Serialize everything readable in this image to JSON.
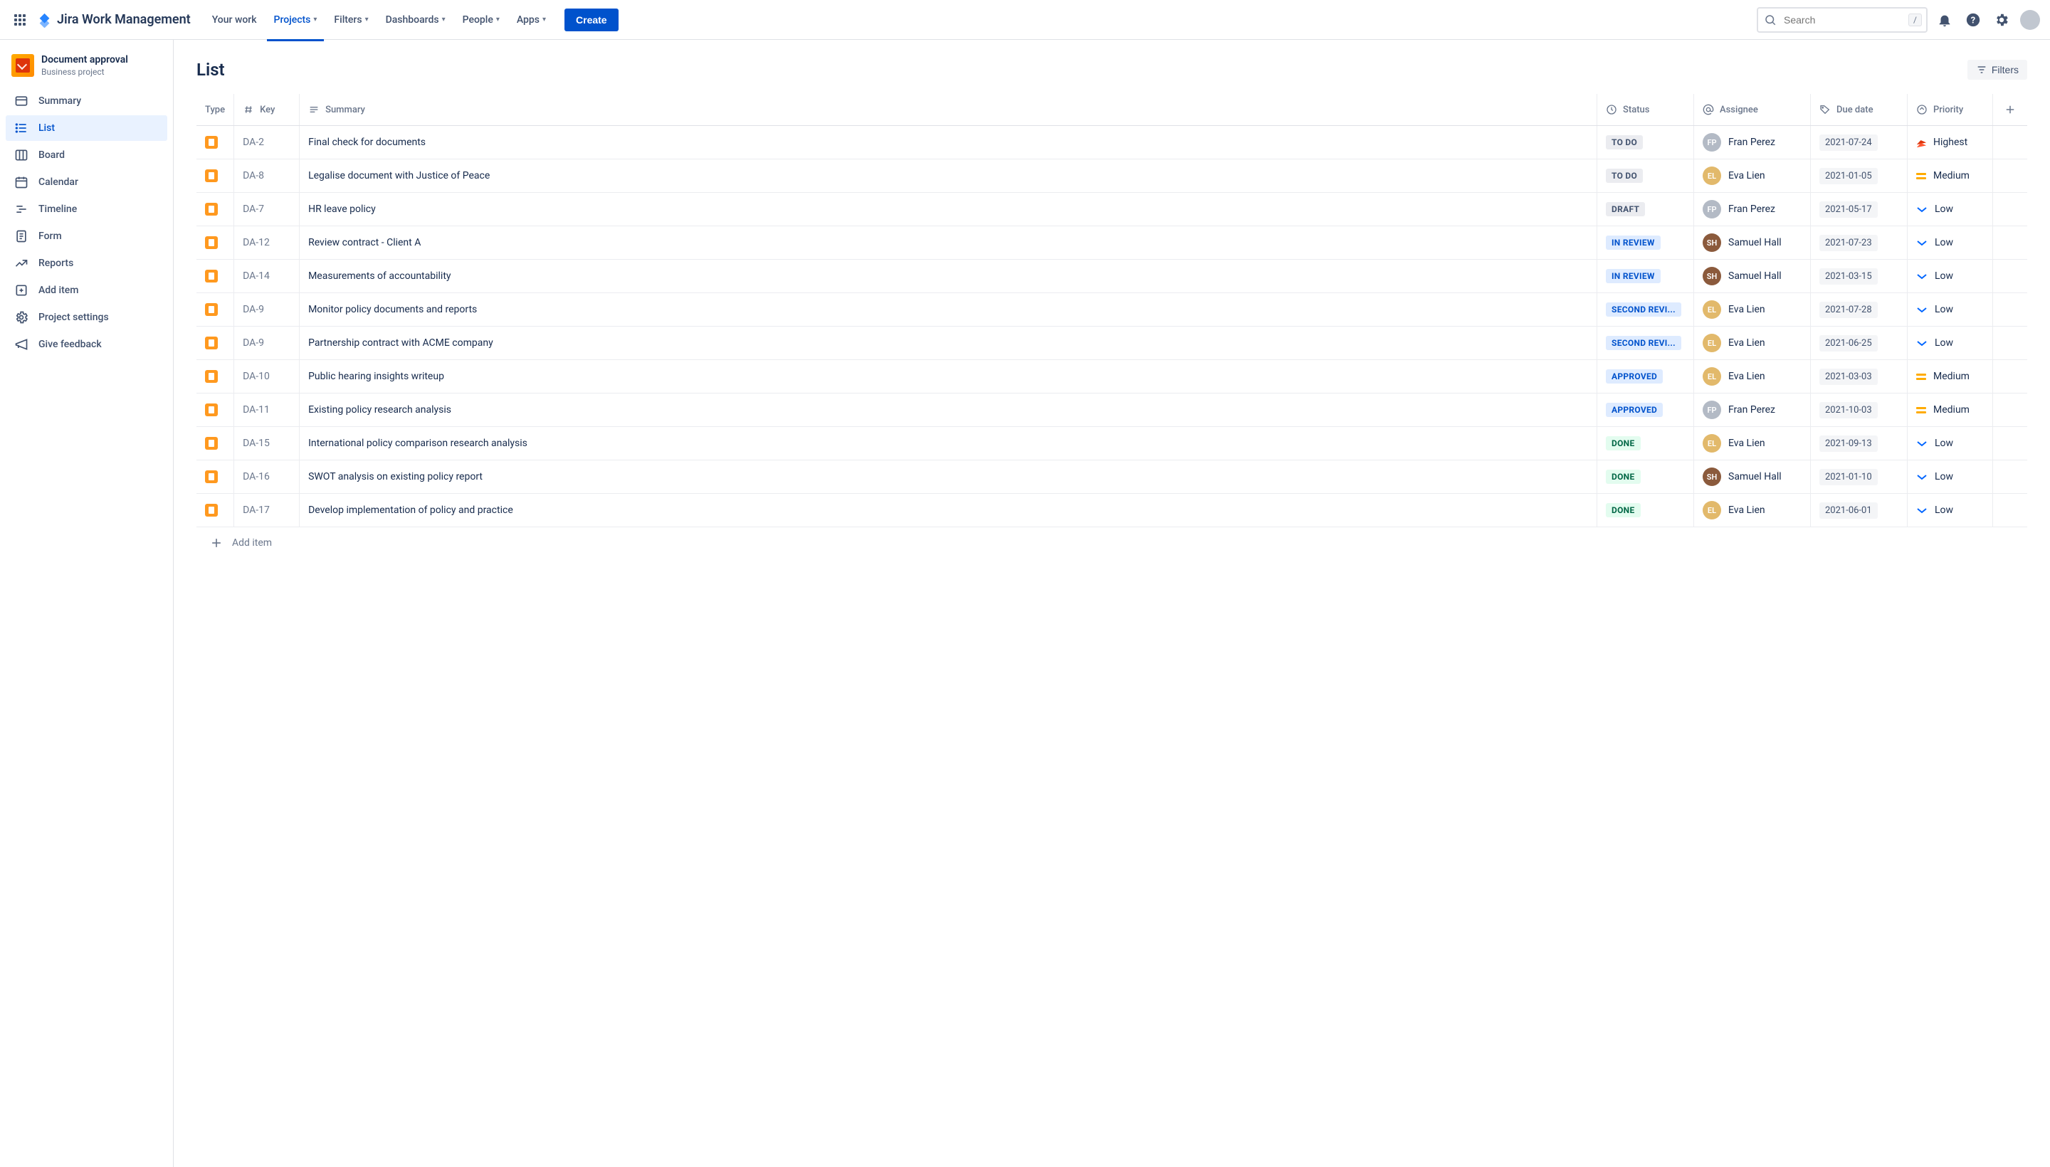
{
  "brand": "Jira Work Management",
  "nav": {
    "your_work": "Your work",
    "projects": "Projects",
    "filters": "Filters",
    "dashboards": "Dashboards",
    "people": "People",
    "apps": "Apps",
    "create": "Create"
  },
  "search": {
    "placeholder": "Search",
    "shortcut": "/"
  },
  "project": {
    "title": "Document approval",
    "subtitle": "Business project"
  },
  "sidebar": {
    "items": [
      {
        "label": "Summary"
      },
      {
        "label": "List"
      },
      {
        "label": "Board"
      },
      {
        "label": "Calendar"
      },
      {
        "label": "Timeline"
      },
      {
        "label": "Form"
      },
      {
        "label": "Reports"
      },
      {
        "label": "Add item"
      },
      {
        "label": "Project settings"
      },
      {
        "label": "Give feedback"
      }
    ]
  },
  "page": {
    "title": "List",
    "filters_btn": "Filters",
    "add_item": "Add item"
  },
  "columns": {
    "type": "Type",
    "key": "Key",
    "summary": "Summary",
    "status": "Status",
    "assignee": "Assignee",
    "due": "Due date",
    "priority": "Priority"
  },
  "rows": [
    {
      "key": "DA-2",
      "summary": "Final check for documents",
      "status": "TO DO",
      "status_class": "status-todo",
      "assignee": "Fran Perez",
      "avatar_bg": "#B3BAC5",
      "due": "2021-07-24",
      "priority": "Highest",
      "prio_type": "highest"
    },
    {
      "key": "DA-8",
      "summary": "Legalise document with Justice of Peace",
      "status": "TO DO",
      "status_class": "status-todo",
      "assignee": "Eva Lien",
      "avatar_bg": "#E2B96B",
      "due": "2021-01-05",
      "priority": "Medium",
      "prio_type": "medium"
    },
    {
      "key": "DA-7",
      "summary": "HR leave policy",
      "status": "DRAFT",
      "status_class": "status-draft",
      "assignee": "Fran Perez",
      "avatar_bg": "#B3BAC5",
      "due": "2021-05-17",
      "priority": "Low",
      "prio_type": "low"
    },
    {
      "key": "DA-12",
      "summary": "Review contract - Client A",
      "status": "IN REVIEW",
      "status_class": "status-inreview",
      "assignee": "Samuel Hall",
      "avatar_bg": "#8B5A3C",
      "due": "2021-07-23",
      "priority": "Low",
      "prio_type": "low"
    },
    {
      "key": "DA-14",
      "summary": "Measurements of accountability",
      "status": "IN REVIEW",
      "status_class": "status-inreview",
      "assignee": "Samuel Hall",
      "avatar_bg": "#8B5A3C",
      "due": "2021-03-15",
      "priority": "Low",
      "prio_type": "low"
    },
    {
      "key": "DA-9",
      "summary": "Monitor policy documents and reports",
      "status": "SECOND REVI...",
      "status_class": "status-second",
      "assignee": "Eva Lien",
      "avatar_bg": "#E2B96B",
      "due": "2021-07-28",
      "priority": "Low",
      "prio_type": "low"
    },
    {
      "key": "DA-9",
      "summary": "Partnership contract with ACME company",
      "status": "SECOND REVI...",
      "status_class": "status-second",
      "assignee": "Eva Lien",
      "avatar_bg": "#E2B96B",
      "due": "2021-06-25",
      "priority": "Low",
      "prio_type": "low"
    },
    {
      "key": "DA-10",
      "summary": "Public hearing insights writeup",
      "status": "APPROVED",
      "status_class": "status-approved",
      "assignee": "Eva Lien",
      "avatar_bg": "#E2B96B",
      "due": "2021-03-03",
      "priority": "Medium",
      "prio_type": "medium"
    },
    {
      "key": "DA-11",
      "summary": "Existing policy research analysis",
      "status": "APPROVED",
      "status_class": "status-approved",
      "assignee": "Fran Perez",
      "avatar_bg": "#B3BAC5",
      "due": "2021-10-03",
      "priority": "Medium",
      "prio_type": "medium"
    },
    {
      "key": "DA-15",
      "summary": "International policy comparison research analysis",
      "status": "DONE",
      "status_class": "status-done",
      "assignee": "Eva Lien",
      "avatar_bg": "#E2B96B",
      "due": "2021-09-13",
      "priority": "Low",
      "prio_type": "low"
    },
    {
      "key": "DA-16",
      "summary": "SWOT analysis on existing policy report",
      "status": "DONE",
      "status_class": "status-done",
      "assignee": "Samuel Hall",
      "avatar_bg": "#8B5A3C",
      "due": "2021-01-10",
      "priority": "Low",
      "prio_type": "low"
    },
    {
      "key": "DA-17",
      "summary": "Develop implementation of policy and practice",
      "status": "DONE",
      "status_class": "status-done",
      "assignee": "Eva Lien",
      "avatar_bg": "#E2B96B",
      "due": "2021-06-01",
      "priority": "Low",
      "prio_type": "low"
    }
  ]
}
